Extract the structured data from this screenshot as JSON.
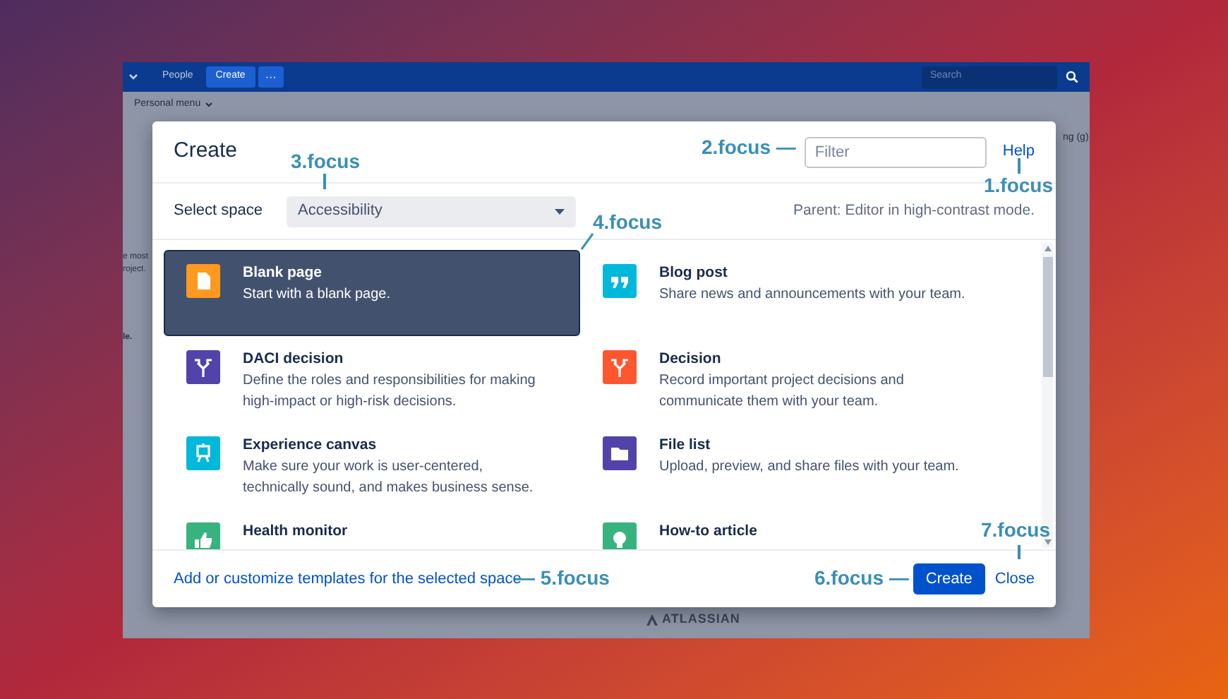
{
  "nav": {
    "items": [
      {
        "label": "People",
        "selected": false
      },
      {
        "label": "Create",
        "selected": true
      }
    ],
    "more": "···",
    "search_placeholder": "Search"
  },
  "personal_menu": "Personal menu",
  "background_fragments": [
    "ng (g)",
    "e most",
    "roject.",
    "le."
  ],
  "dialog": {
    "title": "Create",
    "filter_placeholder": "Filter",
    "help": "Help",
    "select_label": "Select space",
    "space": "Accessibility",
    "parent": "Parent: Editor in high-contrast mode.",
    "templates": [
      {
        "title": "Blank page",
        "description": "Start with a blank page.",
        "kind": "page",
        "color": "#ff991f",
        "selected": true
      },
      {
        "title": "Blog post",
        "description": "Share news and announcements with your team.",
        "kind": "quote",
        "color": "#00b8d9",
        "selected": false
      },
      {
        "title": "DACI decision",
        "description": "Define the roles and responsibilities for making high-impact or high-risk decisions.",
        "kind": "fork",
        "color": "#5243aa",
        "selected": false
      },
      {
        "title": "Decision",
        "description": "Record important project decisions and communicate them with your team.",
        "kind": "fork",
        "color": "#ff5630",
        "selected": false
      },
      {
        "title": "Experience canvas",
        "description": "Make sure your work is user-centered, technically sound, and makes business sense.",
        "kind": "easel",
        "color": "#00b8d9",
        "selected": false
      },
      {
        "title": "File list",
        "description": "Upload, preview, and share files with your team.",
        "kind": "folder",
        "color": "#5243aa",
        "selected": false
      },
      {
        "title": "Health monitor",
        "kind": "thumb",
        "color": "#36b37e",
        "selected": false
      },
      {
        "title": "How-to article",
        "kind": "bulb",
        "color": "#36b37e",
        "selected": false
      }
    ],
    "footer_link": "Add or customize templates for the selected space",
    "create_button": "Create",
    "close": "Close"
  },
  "brand": "ATLASSIAN",
  "annotations": [
    {
      "label": "1.focus"
    },
    {
      "label": "2.focus —"
    },
    {
      "label": "3.focus"
    },
    {
      "label": "4.focus"
    },
    {
      "label": "— 5.focus"
    },
    {
      "label": "6.focus —"
    },
    {
      "label": "7.focus"
    }
  ]
}
